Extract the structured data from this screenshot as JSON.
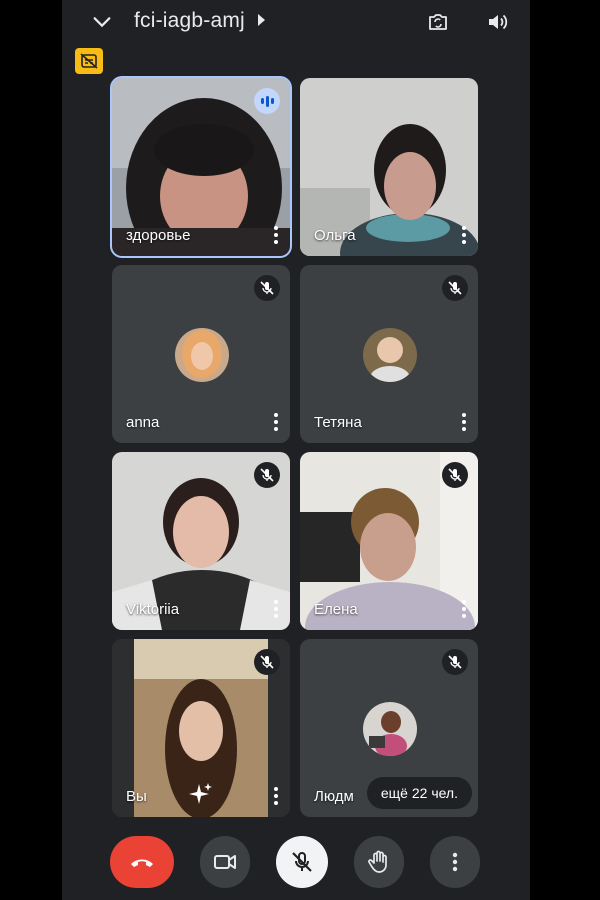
{
  "header": {
    "meeting_code": "fci-iagb-amj"
  },
  "participants": [
    {
      "name": "здоровье",
      "type": "video",
      "speaking": true,
      "muted": false
    },
    {
      "name": "Ольга",
      "type": "video",
      "speaking": false,
      "muted": false
    },
    {
      "name": "anna",
      "type": "avatar",
      "speaking": false,
      "muted": true
    },
    {
      "name": "Тетяна",
      "type": "avatar",
      "speaking": false,
      "muted": true
    },
    {
      "name": "Viktoriia",
      "type": "video",
      "speaking": false,
      "muted": true
    },
    {
      "name": "Елена",
      "type": "video",
      "speaking": false,
      "muted": true
    },
    {
      "name": "Вы",
      "type": "video",
      "speaking": false,
      "muted": true
    },
    {
      "name": "Людм",
      "type": "avatar",
      "speaking": false,
      "muted": true
    }
  ],
  "more_people": "ещё 22 чел.",
  "icons": {
    "header": [
      "chevron-down-icon",
      "switch-camera-icon",
      "speaker-icon"
    ],
    "caption": "captions-off-icon",
    "controls": [
      "end-call-icon",
      "camera-icon",
      "mic-off-icon",
      "raise-hand-icon",
      "more-options-icon"
    ]
  },
  "colors": {
    "background": "#202124",
    "tile": "#3c4043",
    "end_call": "#ea4335",
    "active_outline": "#a8c7fa",
    "caption_badge": "#f9bc15"
  }
}
